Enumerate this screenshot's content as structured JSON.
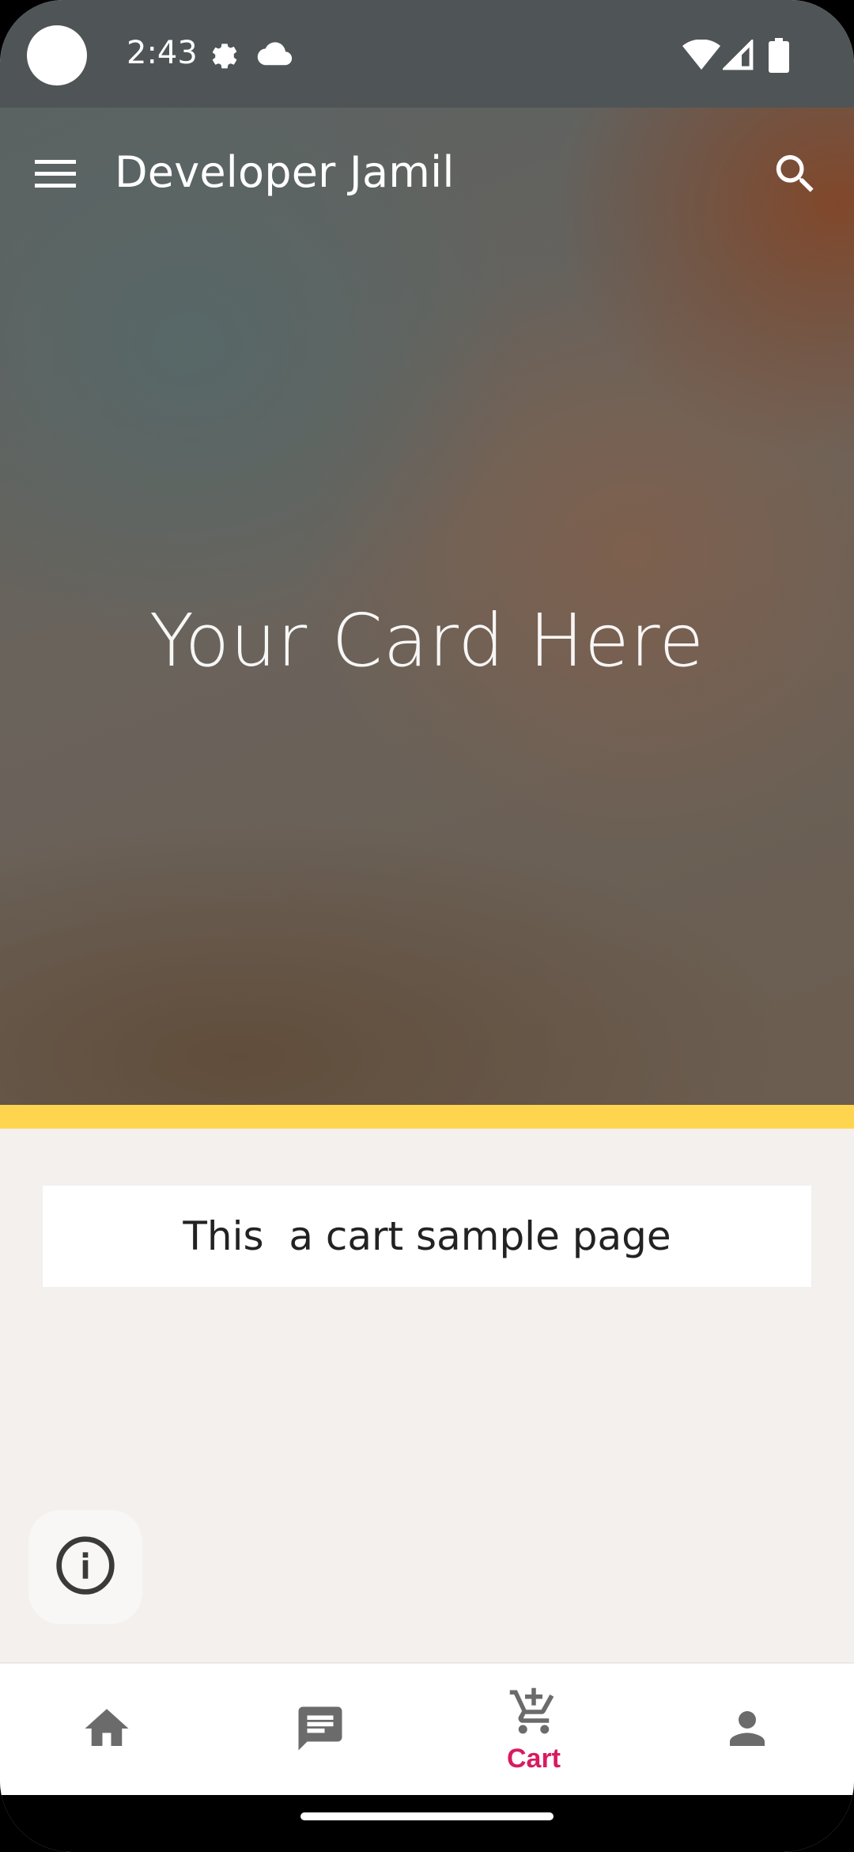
{
  "status_bar": {
    "time": "2:43",
    "icons": [
      "settings-gear-icon",
      "cloud-icon",
      "wifi-icon",
      "signal-icon",
      "battery-icon"
    ]
  },
  "app_bar": {
    "title": "Developer Jamil",
    "menu_icon": "hamburger-menu-icon",
    "search_icon": "search-icon"
  },
  "hero": {
    "text": "Your Card Here"
  },
  "content": {
    "card_text": "This  a cart sample page",
    "fab_icon": "info-icon"
  },
  "bottom_nav": {
    "items": [
      {
        "icon": "home-icon",
        "label": ""
      },
      {
        "icon": "chat-icon",
        "label": ""
      },
      {
        "icon": "add-to-cart-icon",
        "label": "Cart",
        "selected": true
      },
      {
        "icon": "person-icon",
        "label": ""
      }
    ]
  },
  "colors": {
    "status_bar": "#4f5556",
    "accent_strip": "#ffd54f",
    "selected_nav": "#d81b60",
    "nav_icon": "#6b6b6b",
    "background": "#f3f0ed"
  }
}
